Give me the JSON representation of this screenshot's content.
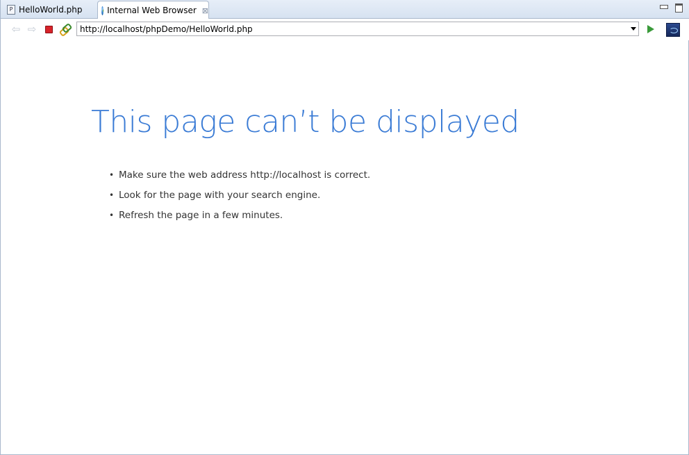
{
  "tabs": [
    {
      "label": "HelloWorld.php",
      "icon": "php-file-icon",
      "active": false
    },
    {
      "label": "Internal Web Browser",
      "icon": "globe-icon",
      "active": true,
      "close": "⊠"
    }
  ],
  "toolbar": {
    "back": "⇦",
    "forward": "⇨",
    "url": "http://localhost/phpDemo/HelloWorld.php"
  },
  "page": {
    "title": "This page can’t be displayed",
    "bullet": "•",
    "suggestions": [
      "Make sure the web address http://localhost is correct.",
      "Look for the page with your search engine.",
      "Refresh the page in a few minutes."
    ],
    "title_color": "#3a7bd5"
  }
}
